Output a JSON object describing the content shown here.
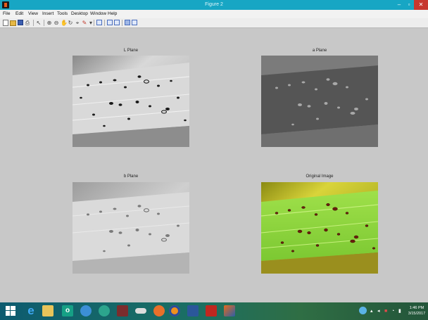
{
  "window": {
    "title": "Figure 2",
    "minimize_glyph": "–",
    "maximize_glyph": "▫",
    "close_glyph": "✕"
  },
  "menu": {
    "items": [
      "File",
      "Edit",
      "View",
      "Insert",
      "Tools",
      "Desktop",
      "Window",
      "Help"
    ]
  },
  "toolbar": {
    "icons": [
      "new-figure-icon",
      "open-file-icon",
      "save-icon",
      "print-icon",
      "pointer-icon",
      "zoom-in-icon",
      "zoom-out-icon",
      "pan-icon",
      "rotate-icon",
      "data-cursor-icon",
      "brush-icon",
      "link-plot-icon",
      "colorbar-icon",
      "legend-icon",
      "hide-tools-icon",
      "dock-icon"
    ]
  },
  "plots": [
    {
      "title": "L Plane"
    },
    {
      "title": "a Plane"
    },
    {
      "title": "b Plane"
    },
    {
      "title": "Original Image"
    }
  ],
  "taskbar": {
    "apps": [
      "start-icon",
      "internet-explorer-icon",
      "file-explorer-icon",
      "office-icon",
      "paint-icon",
      "color-app-icon",
      "media-app-icon",
      "eraser-app-icon",
      "picasa-icon",
      "firefox-icon",
      "word-icon",
      "acrobat-icon",
      "matlab-icon"
    ],
    "clock": {
      "time": "1:46 PM",
      "date": "3/15/2017"
    }
  },
  "colors": {
    "titlebar": "#17a6c4",
    "close_button": "#c7372f",
    "figure_background": "#c8c8c8"
  }
}
